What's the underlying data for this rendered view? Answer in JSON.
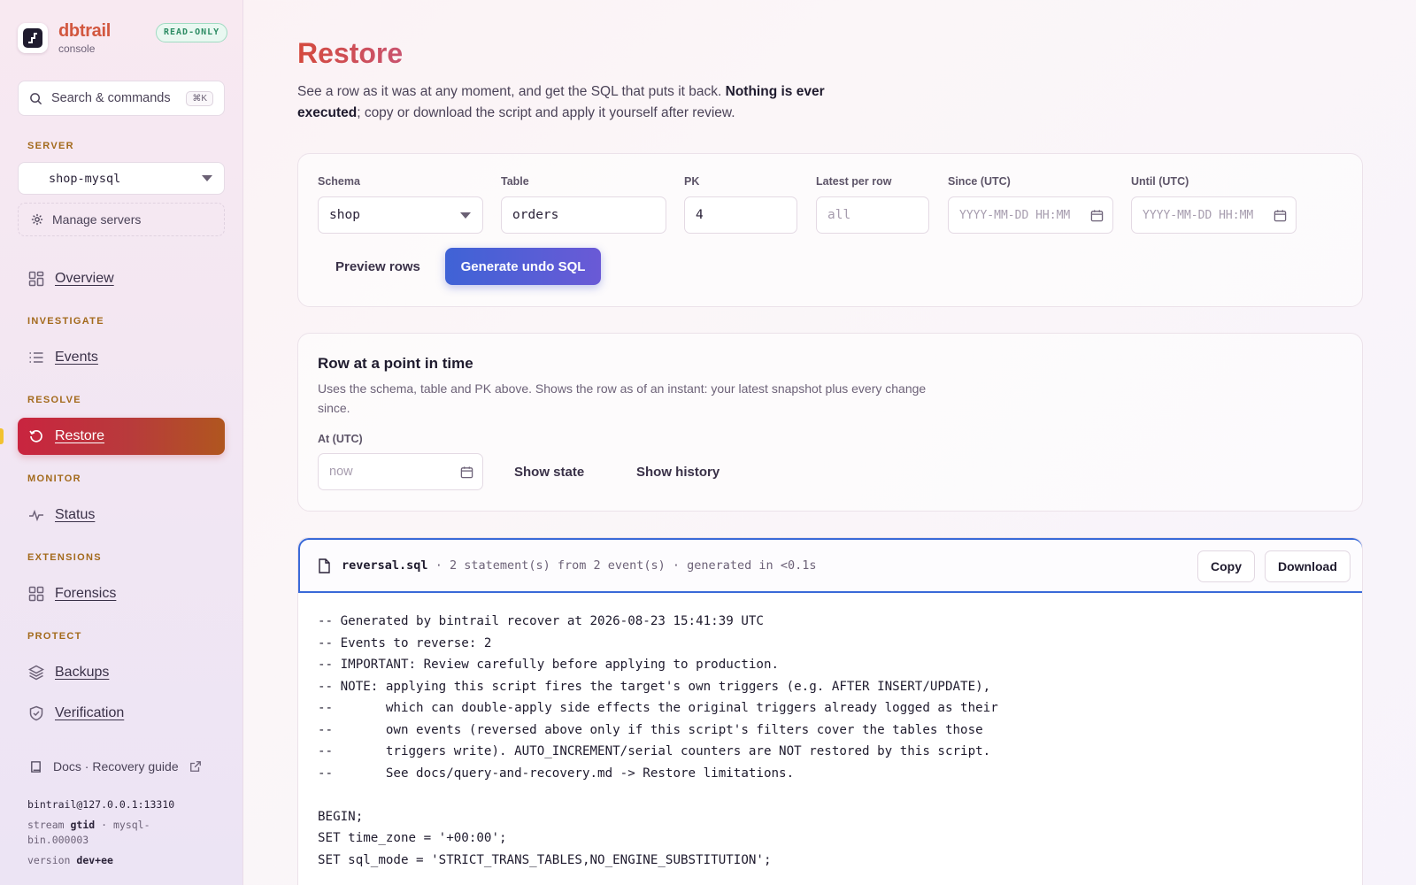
{
  "app": {
    "name": "dbtrail",
    "subtitle": "console",
    "mode_badge": "READ-ONLY"
  },
  "search": {
    "label": "Search & commands",
    "shortcut": "⌘K"
  },
  "sidebar": {
    "server_section": "SERVER",
    "server_selected": "shop-mysql",
    "manage_servers": "Manage servers",
    "overview": "Overview",
    "sections": {
      "investigate": "INVESTIGATE",
      "resolve": "RESOLVE",
      "monitor": "MONITOR",
      "extensions": "EXTENSIONS",
      "protect": "PROTECT"
    },
    "items": {
      "events": "Events",
      "restore": "Restore",
      "status": "Status",
      "forensics": "Forensics",
      "backups": "Backups",
      "verification": "Verification"
    },
    "docs_link": "Docs · Recovery guide",
    "footer": {
      "connection": "bintrail@127.0.0.1:13310",
      "stream_prefix": "stream",
      "stream_mode": "gtid",
      "stream_file_a": "· mysql-",
      "stream_file_b": "bin.000003",
      "version_prefix": "version",
      "version": "dev+ee"
    }
  },
  "page": {
    "title": "Restore",
    "description_a": "See a row as it was at any moment, and get the SQL that puts it back.",
    "description_bold": "Nothing is ever executed",
    "description_b": "; copy or download the script and apply it yourself after review."
  },
  "form": {
    "schema_label": "Schema",
    "schema_value": "shop",
    "table_label": "Table",
    "table_value": "orders",
    "pk_label": "PK",
    "pk_value": "4",
    "latest_label": "Latest per row",
    "latest_placeholder": "all",
    "since_label": "Since (UTC)",
    "since_placeholder": "YYYY-MM-DD HH:MM",
    "until_label": "Until (UTC)",
    "until_placeholder": "YYYY-MM-DD HH:MM",
    "preview_button": "Preview rows",
    "generate_button": "Generate undo SQL"
  },
  "point_in_time": {
    "title": "Row at a point in time",
    "description": "Uses the schema, table and PK above. Shows the row as of an instant: your latest snapshot plus every change since.",
    "at_label": "At (UTC)",
    "at_placeholder": "now",
    "show_state": "Show state",
    "show_history": "Show history"
  },
  "sql_output": {
    "filename": "reversal.sql",
    "meta": "· 2 statement(s) from 2 event(s) · generated in <0.1s",
    "copy_button": "Copy",
    "download_button": "Download",
    "lines": [
      "-- Generated by bintrail recover at 2026-08-23 15:41:39 UTC",
      "-- Events to reverse: 2",
      "-- IMPORTANT: Review carefully before applying to production.",
      "-- NOTE: applying this script fires the target's own triggers (e.g. AFTER INSERT/UPDATE),",
      "--       which can double-apply side effects the original triggers already logged as their",
      "--       own events (reversed above only if this script's filters cover the tables those",
      "--       triggers write). AUTO_INCREMENT/serial counters are NOT restored by this script.",
      "--       See docs/query-and-recovery.md -> Restore limitations.",
      "",
      "BEGIN;",
      "SET time_zone = '+00:00';",
      "SET sql_mode = 'STRICT_TRANS_TABLES,NO_ENGINE_SUBSTITUTION';"
    ]
  },
  "colors": {
    "accent_red": "#c9243f",
    "accent_orange": "#b0561f",
    "primary_blue": "#3f63d6",
    "section_label": "#a36a1c"
  }
}
